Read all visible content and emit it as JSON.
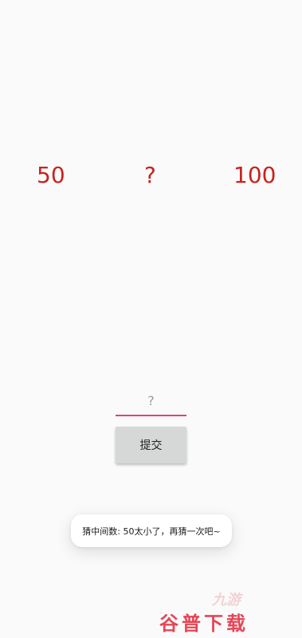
{
  "range": {
    "low": "50",
    "mystery": "?",
    "high": "100"
  },
  "guess": {
    "value": "",
    "placeholder": "?"
  },
  "submit_label": "提交",
  "toast_message": "猜中间数: 50太小了，再猜一次吧~",
  "watermark": {
    "text": "谷普下载",
    "logo": "九游"
  },
  "colors": {
    "number_red": "#c8231f",
    "input_underline": "#e0407e",
    "button_gray": "#d6d7d7",
    "watermark_red": "#e43245"
  }
}
